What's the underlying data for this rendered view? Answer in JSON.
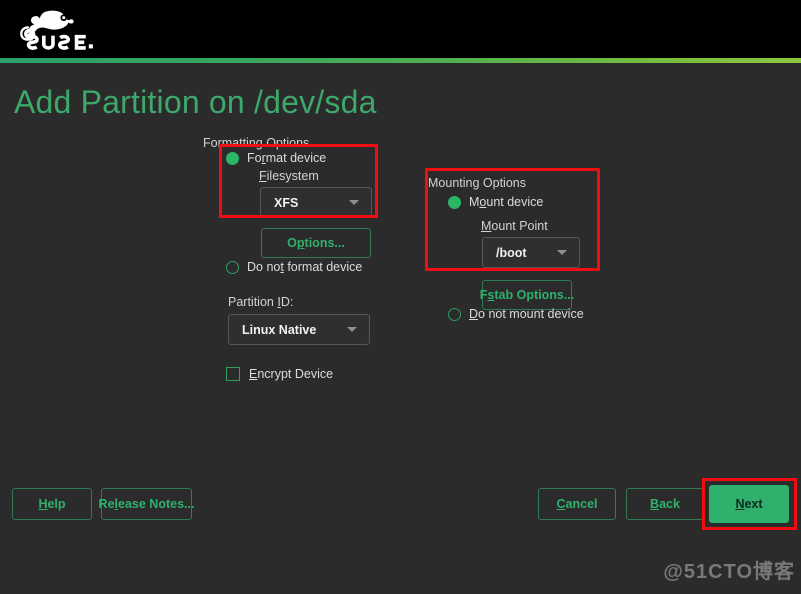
{
  "header": {
    "logo_name": "suse-logo",
    "logo_text": "SUSE.",
    "accent_gradient_start": "#2ba06b",
    "accent_gradient_end": "#8cc63f"
  },
  "page_title": "Add Partition on /dev/sda",
  "formatting": {
    "group_label": "Formatting Options",
    "format_device": {
      "label_pre": "Fo",
      "label_accel": "r",
      "label_post": "mat device",
      "selected": true
    },
    "filesystem_label_pre": "",
    "filesystem_label_accel": "F",
    "filesystem_label_post": "ilesystem",
    "filesystem_value": "XFS",
    "options_button_pre": "O",
    "options_button_accel": "p",
    "options_button_post": "tions...",
    "do_not_format": {
      "label_pre": "Do no",
      "label_accel": "t",
      "label_post": " format device",
      "selected": false
    },
    "partition_id_label_pre": "Partition ",
    "partition_id_label_accel": "I",
    "partition_id_label_post": "D:",
    "partition_id_value": "Linux Native",
    "encrypt_pre": "",
    "encrypt_accel": "E",
    "encrypt_post": "ncrypt Device",
    "encrypt_checked": false
  },
  "mounting": {
    "group_label": "Mounting Options",
    "mount_device": {
      "label_pre": "M",
      "label_accel": "o",
      "label_post": "unt device",
      "selected": true
    },
    "mount_point_label_pre": "",
    "mount_point_label_accel": "M",
    "mount_point_label_post": "ount Point",
    "mount_point_value": "/boot",
    "fstab_button_pre": "F",
    "fstab_button_accel": "s",
    "fstab_button_post": "tab Options...",
    "do_not_mount": {
      "label_pre": "",
      "label_accel": "D",
      "label_post": "o not mount device",
      "selected": false
    }
  },
  "footer": {
    "help_pre": "",
    "help_accel": "H",
    "help_post": "elp",
    "release_notes_pre": "Re",
    "release_notes_accel": "l",
    "release_notes_post": "ease Notes...",
    "cancel_pre": "",
    "cancel_accel": "C",
    "cancel_post": "ancel",
    "back_pre": "",
    "back_accel": "B",
    "back_post": "ack",
    "next_pre": "",
    "next_accel": "N",
    "next_post": "ext"
  },
  "highlights": {
    "color": "#f20d12",
    "count": 3
  },
  "watermark": "@51CTO博客"
}
